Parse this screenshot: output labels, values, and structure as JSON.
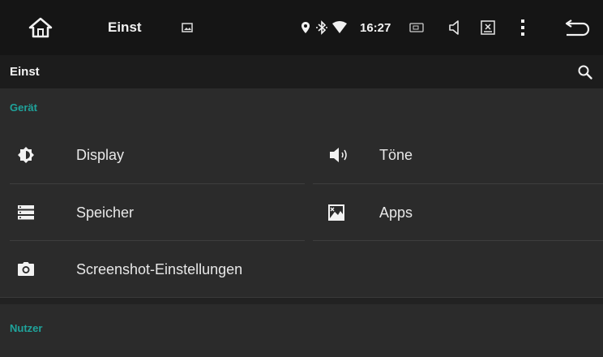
{
  "statusbar": {
    "title": "Einst",
    "time": "16:27",
    "icons": [
      "home-icon",
      "image-icon",
      "location-icon",
      "bluetooth-icon",
      "wifi-icon",
      "battery-icon",
      "volume-icon",
      "close-box-icon",
      "more-vert-icon",
      "back-icon"
    ]
  },
  "appbar": {
    "title": "Einst",
    "search_icon": "search-icon"
  },
  "sections": {
    "device": {
      "header": "Gerät",
      "items": [
        {
          "label": "Display",
          "icon": "brightness-icon"
        },
        {
          "label": "Töne",
          "icon": "volume-icon"
        },
        {
          "label": "Speicher",
          "icon": "storage-icon"
        },
        {
          "label": "Apps",
          "icon": "apps-icon"
        },
        {
          "label": "Screenshot-Einstellungen",
          "icon": "camera-icon"
        }
      ]
    },
    "user": {
      "header": "Nutzer"
    }
  },
  "colors": {
    "accent": "#1fa39b",
    "statusbar_bg": "#151515",
    "appbar_bg": "#1c1c1c",
    "content_bg": "#2b2b2b"
  }
}
